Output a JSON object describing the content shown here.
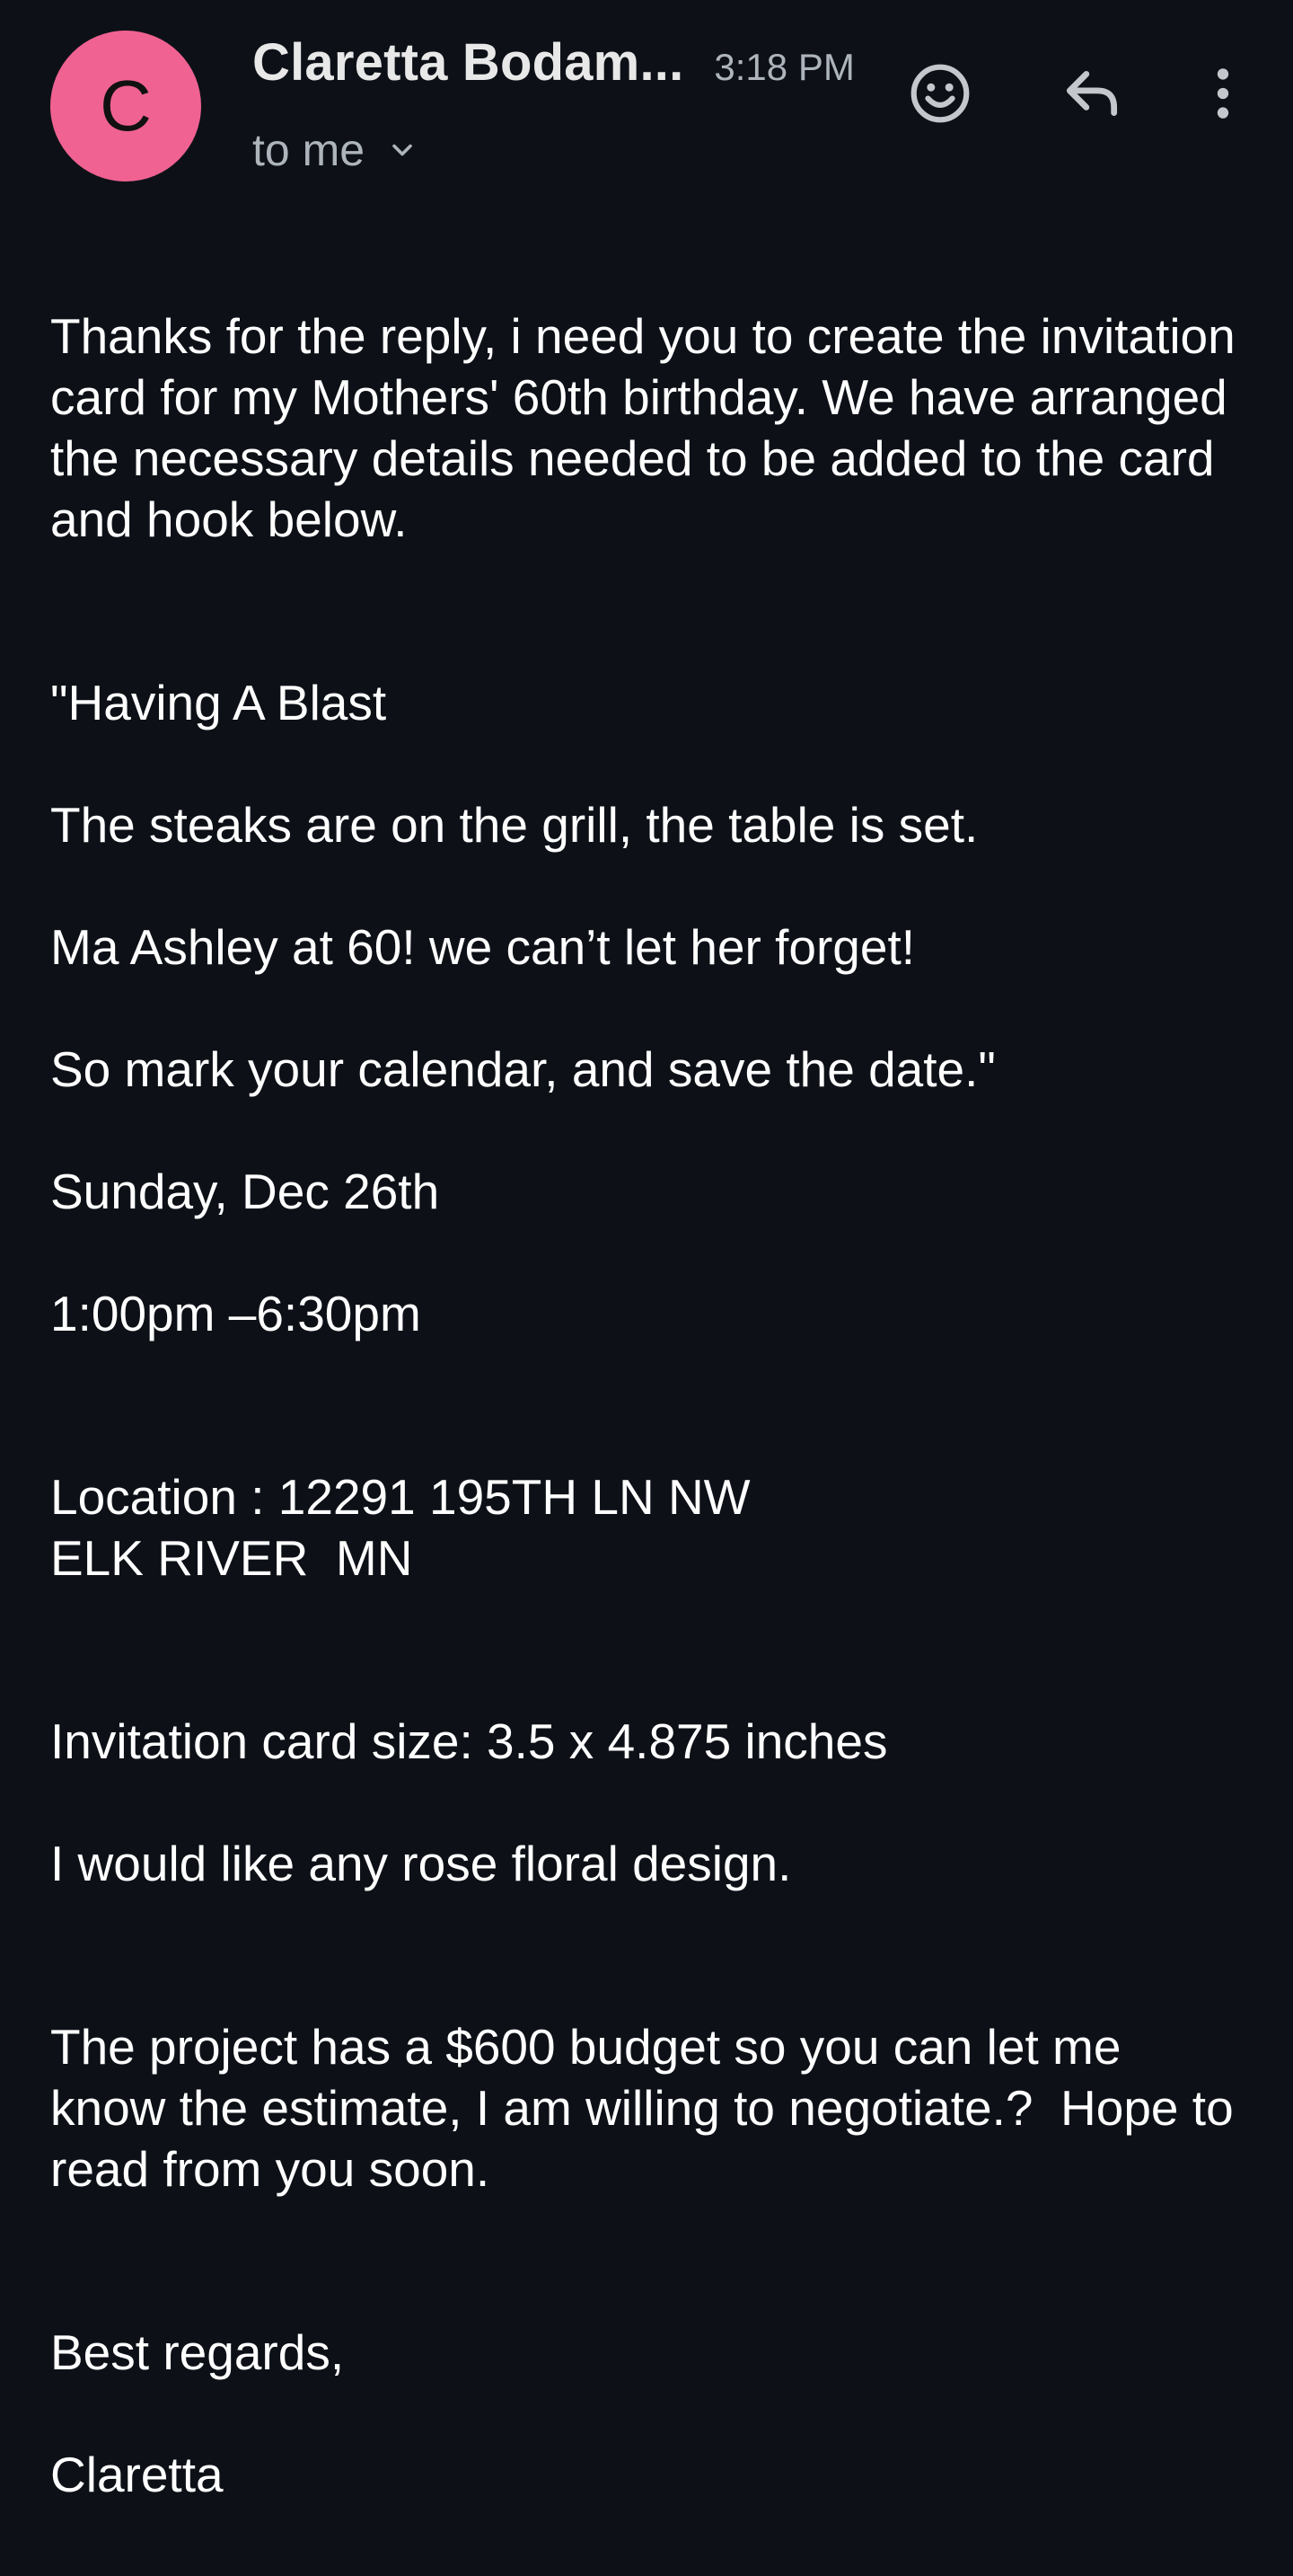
{
  "header": {
    "avatar_letter": "C",
    "sender_name": "Claretta Bodam...",
    "time": "3:18 PM",
    "to_label": "to me",
    "icons": {
      "emoji": "emoji-smile-icon",
      "reply": "reply-icon",
      "more": "more-vert-icon"
    }
  },
  "colors": {
    "background": "#0d1117",
    "avatar": "#f06292",
    "secondary_text": "#aeb4bc"
  },
  "message": {
    "intro": "Thanks for the reply, i need you to create the invitation card for my Mothers' 60th birthday. We have arranged the necessary details needed to be added to the card and hook below.",
    "quote_title": "\"Having A Blast",
    "quote_line1": "The steaks are on the grill, the table is set.",
    "quote_line2": "Ma Ashley at 60! we can’t let her forget!",
    "quote_line3": "So mark your calendar, and save the date.\"",
    "date": "Sunday, Dec 26th",
    "time_range": "1:00pm –6:30pm",
    "location_line1": "Location : 12291 195TH LN NW",
    "location_line2": "ELK RIVER  MN",
    "card_size": "Invitation card size: 3.5 x 4.875 inches",
    "design": "I would like any rose floral design.",
    "budget": "The project has a $600 budget so you can let me know the estimate, I am willing to negotiate.?  Hope to read from you soon.",
    "sign_off": "Best regards,",
    "signature": "Claretta"
  }
}
